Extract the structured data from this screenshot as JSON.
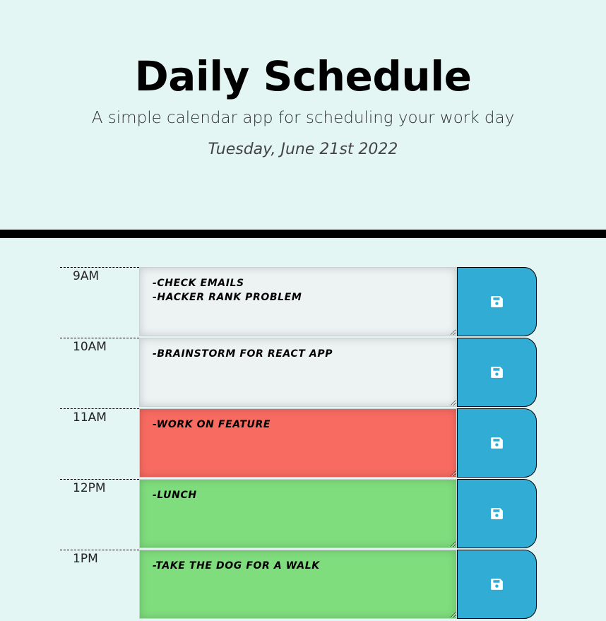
{
  "header": {
    "title": "Daily Schedule",
    "lead": "A simple calendar app for scheduling your work day",
    "current_day": "Tuesday, June 21st 2022"
  },
  "colors": {
    "background": "#e3f6f4",
    "past": "#edf3f3",
    "present": "#f86b61",
    "future": "#7fdd7d",
    "save_button": "#31acd5"
  },
  "time_blocks": [
    {
      "hour": "9AM",
      "text": "-check emails\n-hacker rank problem",
      "status": "past",
      "icon": "save-icon"
    },
    {
      "hour": "10AM",
      "text": "-brainstorm for react app",
      "status": "past",
      "icon": "save-icon"
    },
    {
      "hour": "11AM",
      "text": "-work on feature",
      "status": "present",
      "icon": "save-icon"
    },
    {
      "hour": "12PM",
      "text": "-lunch",
      "status": "future",
      "icon": "save-icon"
    },
    {
      "hour": "1PM",
      "text": "-take the dog for a walk",
      "status": "future",
      "icon": "save-icon"
    }
  ]
}
